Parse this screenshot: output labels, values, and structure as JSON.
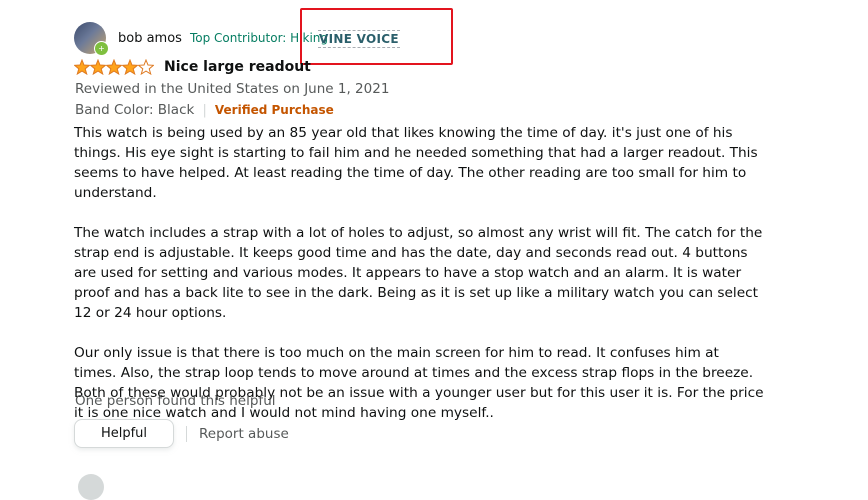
{
  "profile": {
    "name": "bob amos",
    "contributor": "Top Contributor: Hiking",
    "badge": "VINE VOICE"
  },
  "review": {
    "rating": 4,
    "rating_max": 5,
    "title": "Nice large readout",
    "meta": "Reviewed in the United States on June 1, 2021",
    "variant": "Band Color: Black",
    "verified": "Verified Purchase",
    "paragraphs": [
      "This watch is being used by an 85 year old that likes knowing the time of day. it's just one of his things. His eye sight is starting to fail him and he needed something that had a larger readout. This seems to have helped. At least reading the time of day. The other reading are too small for him to understand.",
      "The watch includes a strap with a lot of holes to adjust, so almost any wrist will fit. The catch for the strap end is adjustable. It keeps good time and has the date, day and seconds read out. 4 buttons are used for setting and various modes. It appears to have a stop watch and an alarm. It is water proof and has a back lite to see in the dark. Being as it is set up like a military watch you can select 12 or 24 hour options.",
      "Our only issue is that there is too much on the main screen for him to read. It confuses him at times. Also, the strap loop tends to move around at times and the excess strap flops in the breeze. Both of these would probably not be an issue with a younger user but for this user it is. For the price it is one nice watch and I would not mind having one myself.."
    ],
    "helpful_count": "One person found this helpful",
    "helpful_label": "Helpful",
    "report_label": "Report abuse"
  },
  "colors": {
    "star": "#ffa41c",
    "highlight": "#e3141e",
    "verified": "#c45500",
    "contributor": "#067d62"
  }
}
